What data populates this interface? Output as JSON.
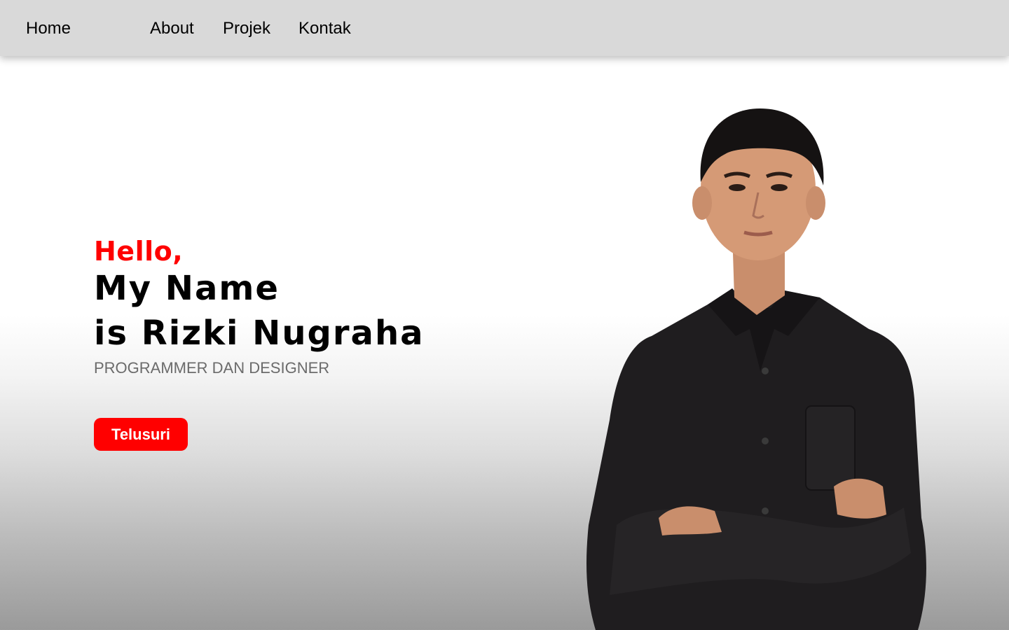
{
  "nav": {
    "home": "Home",
    "about": "About",
    "projek": "Projek",
    "kontak": "Kontak"
  },
  "hero": {
    "greeting": "Hello,",
    "line1": "My Name",
    "line2": "is Rizki Nugraha",
    "subtitle": "PROGRAMMER DAN DESIGNER",
    "button": "Telusuri"
  },
  "colors": {
    "accent": "#ff0000",
    "navbar": "#d9d9d9",
    "shirt": "#1f1d1f",
    "skin": "#d59a76",
    "hair": "#151212"
  },
  "icons": {
    "portrait": "person-photo"
  }
}
